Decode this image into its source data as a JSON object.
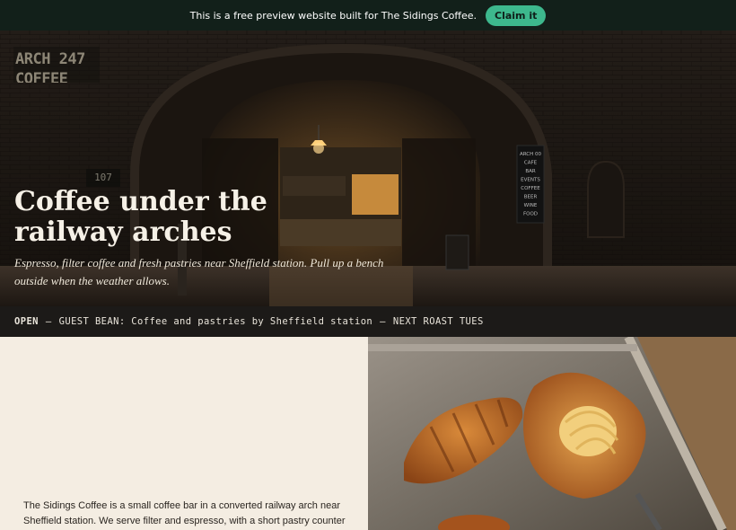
{
  "banner": {
    "text": "This is a free preview website built for The Sidings Coffee.",
    "claim_label": "Claim it"
  },
  "hero": {
    "sign_text": "ARCH 247 COFFEE",
    "arch_number": "107",
    "title": "Coffee under the railway arches",
    "subtitle": "Espresso, filter coffee and fresh pastries near Sheffield station. Pull up a bench outside when the weather allows.",
    "menu_board": [
      "ARCH 00",
      "CAFE",
      "BAR",
      "EVENTS",
      "COFFEE",
      "BEER",
      "WINE",
      "FOOD"
    ]
  },
  "ticker": {
    "status": "OPEN",
    "sep1": "—",
    "message": "GUEST BEAN: Coffee and pastries by Sheffield station",
    "sep2": "—",
    "next": "NEXT ROAST TUES"
  },
  "intro": {
    "text": "The Sidings Coffee is a small coffee bar in a converted railway arch near Sheffield station. We serve filter and espresso, with a short pastry counter and"
  },
  "colors": {
    "banner_bg": "#12201a",
    "accent": "#3db88d",
    "ticker_bg": "#1c1a18",
    "cream_bg": "#f4ede2"
  }
}
